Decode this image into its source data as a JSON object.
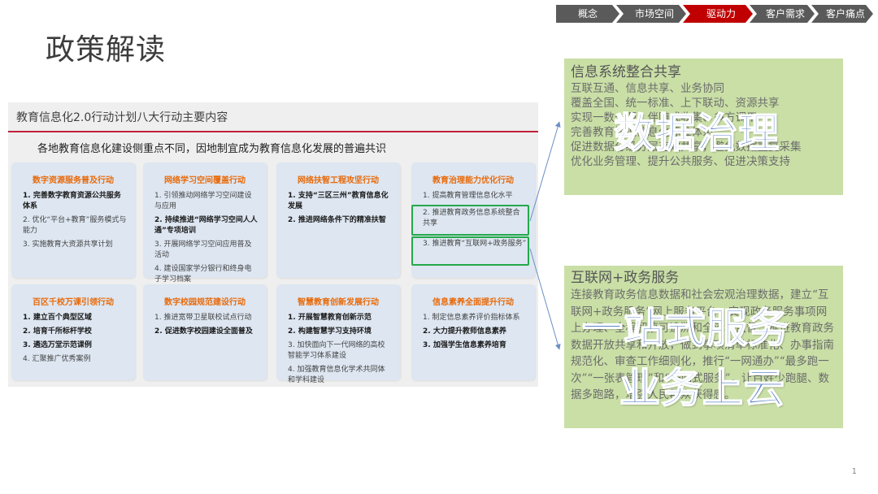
{
  "nav": [
    {
      "label": "概念",
      "active": false
    },
    {
      "label": "市场空间",
      "active": false
    },
    {
      "label": "驱动力",
      "active": true
    },
    {
      "label": "客户需求",
      "active": false
    },
    {
      "label": "客户痛点",
      "active": false
    }
  ],
  "colors": {
    "nav_default": "#5a5a5a",
    "nav_active": "#c00000",
    "card_title": "#e86a0a",
    "highlight": "#24a84a",
    "green_box": "#c9dfa6",
    "overlay_text": "#5d86c6"
  },
  "page_title": "政策解读",
  "panel": {
    "title": "教育信息化2.0行动计划八大行动主要内容",
    "subtitle": "各地教育信息化建设侧重点不同，因地制宜成为教育信息化发展的普遍共识",
    "cards": [
      {
        "title": "数字资源服务普及行动",
        "items": [
          {
            "text": "1. 完善数字教育资源公共服务体系",
            "strong": true
          },
          {
            "text": "2. 优化“平台+教育”服务模式与能力",
            "strong": false
          },
          {
            "text": "3. 实施教育大资源共享计划",
            "strong": false
          }
        ]
      },
      {
        "title": "网络学习空间覆盖行动",
        "items": [
          {
            "text": "1. 引领推动网络学习空间建设与应用",
            "strong": false
          },
          {
            "text": "2. 持续推进“网络学习空间人人通”专项培训",
            "strong": true
          },
          {
            "text": "3. 开展网络学习空间应用普及活动",
            "strong": false
          },
          {
            "text": "4. 建设国家学分银行和终身电子学习档案",
            "strong": false
          }
        ]
      },
      {
        "title": "网络扶智工程攻坚行动",
        "items": [
          {
            "text": "1. 支持“三区三州”教育信息化发展",
            "strong": true
          },
          {
            "text": "2. 推进网络条件下的精准扶智",
            "strong": true
          }
        ]
      },
      {
        "title": "教育治理能力优化行动",
        "items": [
          {
            "text": "1. 提高教育管理信息化水平",
            "strong": false
          },
          {
            "text": "2. 推进教育政务信息系统整合共享",
            "strong": false
          },
          {
            "text": "3. 推进教育“互联网+政务服务”",
            "strong": false
          }
        ]
      },
      {
        "title": "百区千校万课引领行动",
        "items": [
          {
            "text": "1. 建立百个典型区域",
            "strong": true
          },
          {
            "text": "2. 培育千所标杆学校",
            "strong": true
          },
          {
            "text": "3. 遴选万堂示范课例",
            "strong": true
          },
          {
            "text": "4. 汇聚推广优秀案例",
            "strong": false
          }
        ]
      },
      {
        "title": "数字校园规范建设行动",
        "items": [
          {
            "text": "1. 推进宽带卫星联校试点行动",
            "strong": false
          },
          {
            "text": "2. 促进数字校园建设全面普及",
            "strong": true
          }
        ]
      },
      {
        "title": "智慧教育创新发展行动",
        "items": [
          {
            "text": "1. 开展智慧教育创新示范",
            "strong": true
          },
          {
            "text": "2. 构建智慧学习支持环境",
            "strong": true
          },
          {
            "text": "3. 加快面向下一代网络的高校智能学习体系建设",
            "strong": false
          },
          {
            "text": "4. 加强教育信息化学术共同体和学科建设",
            "strong": false
          }
        ]
      },
      {
        "title": "信息素养全面提升行动",
        "items": [
          {
            "text": "1. 制定信息素养评价指标体系",
            "strong": false
          },
          {
            "text": "2. 大力提升教师信息素养",
            "strong": true
          },
          {
            "text": "3. 加强学生信息素养培育",
            "strong": true
          }
        ]
      }
    ]
  },
  "box1": {
    "title": "信息系统整合共享",
    "lines": [
      "互联互通、信息共享、业务协同",
      "覆盖全国、统一标准、上下联动、资源共享",
      "实现一数一源、伴随式收集、多方调用",
      "完善教育管理信息化标准体系",
      "促进数据分级分层有效共享，避免数据重复采集",
      "优化业务管理、提升公共服务、促进决策支持"
    ],
    "overlay": "数据治理"
  },
  "box2": {
    "title": "互联网+政务服务",
    "body": "连接教育政务信息数据和社会宏观治理数据，建立“互联网+政务服务”网上服务平台，实现政务服务事项网上办理、全程留痕可追溯和全流程监督，推进教育政务数据开放共享和开放，做到事项清单标准化、办事指南规范化、审查工作细则化，推行“一网通办”“最多跑一次”“一张表管理”和“一站式服务”，让百姓少跑腿、数据多跑路，增强人民群众获得感。",
    "overlay_1": "一站式服务",
    "overlay_2": "业务上云"
  },
  "page_number": "1"
}
